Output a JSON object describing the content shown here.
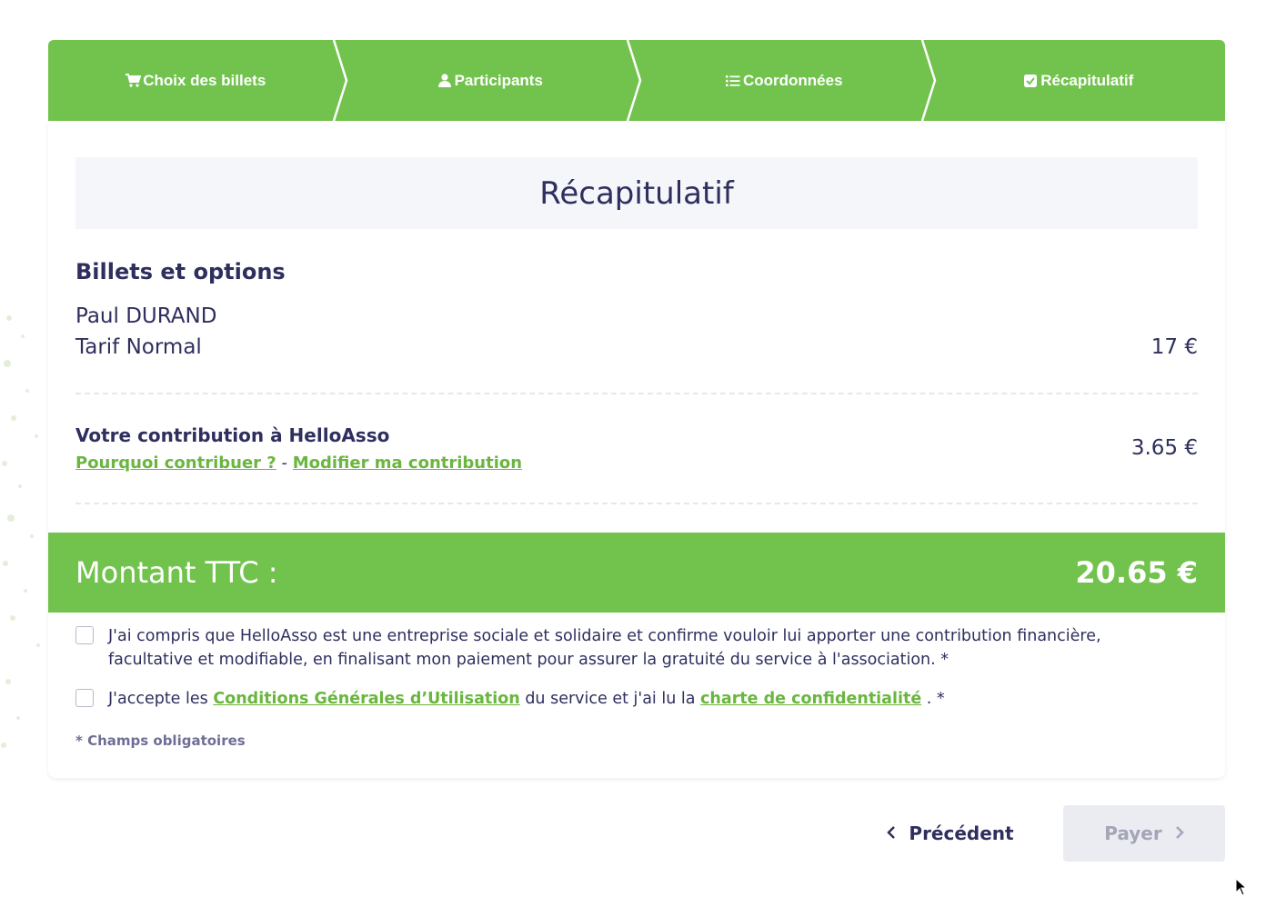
{
  "stepper": {
    "steps": [
      {
        "label": "Choix des billets",
        "icon": "cart-icon"
      },
      {
        "label": "Participants",
        "icon": "user-icon"
      },
      {
        "label": "Coordonnées",
        "icon": "list-icon"
      },
      {
        "label": "Récapitulatif",
        "icon": "check-square-icon"
      }
    ],
    "color": "#72c34d"
  },
  "recap": {
    "title": "Récapitulatif",
    "section_title": "Billets et options",
    "participant_name": "Paul DURAND",
    "tarif_name": "Tarif Normal",
    "tarif_price": "17 €"
  },
  "contribution": {
    "title": "Votre contribution à HelloAsso",
    "why_link": "Pourquoi contribuer ?",
    "separator": "-",
    "modify_link": "Modifier ma contribution",
    "amount": "3.65 €"
  },
  "total": {
    "label": "Montant TTC :",
    "value": "20.65 €"
  },
  "consents": {
    "contribution_text": "J'ai compris que HelloAsso est une entreprise sociale et solidaire et confirme vouloir lui apporter une contribution financière, facultative et modifiable, en finalisant mon paiement pour assurer la gratuité du service à l'association. *",
    "cgu_prefix": "J'accepte les",
    "cgu_link": "Conditions Générales d’Utilisation",
    "cgu_middle": "du service et j'ai lu la",
    "privacy_link": "charte de confidentialité",
    "cgu_suffix": ". *"
  },
  "required_note": "* Champs obligatoires",
  "nav": {
    "previous_label": "Précédent",
    "pay_label": "Payer"
  },
  "colors": {
    "accent": "#72c34d",
    "link": "#6ab63f",
    "text": "#2e2f5e",
    "disabled_bg": "#ebecf1"
  }
}
